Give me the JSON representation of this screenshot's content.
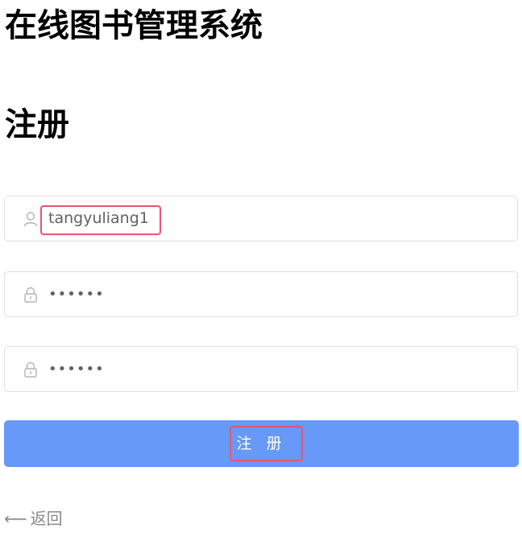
{
  "header": {
    "app_title": "在线图书管理系统"
  },
  "form": {
    "title": "注册",
    "username": {
      "value": "tangyuliang1",
      "icon": "user-icon"
    },
    "password": {
      "value": "••••••",
      "icon": "lock-icon"
    },
    "confirm_password": {
      "value": "••••••",
      "icon": "lock-icon"
    },
    "submit_label": "注 册",
    "back_arrow": "⟵",
    "back_label": "返回"
  },
  "colors": {
    "primary_button": "#6699f8",
    "highlight_border": "#e8556e",
    "input_border": "#dcdfe6",
    "muted_text": "#8a8a8a"
  }
}
